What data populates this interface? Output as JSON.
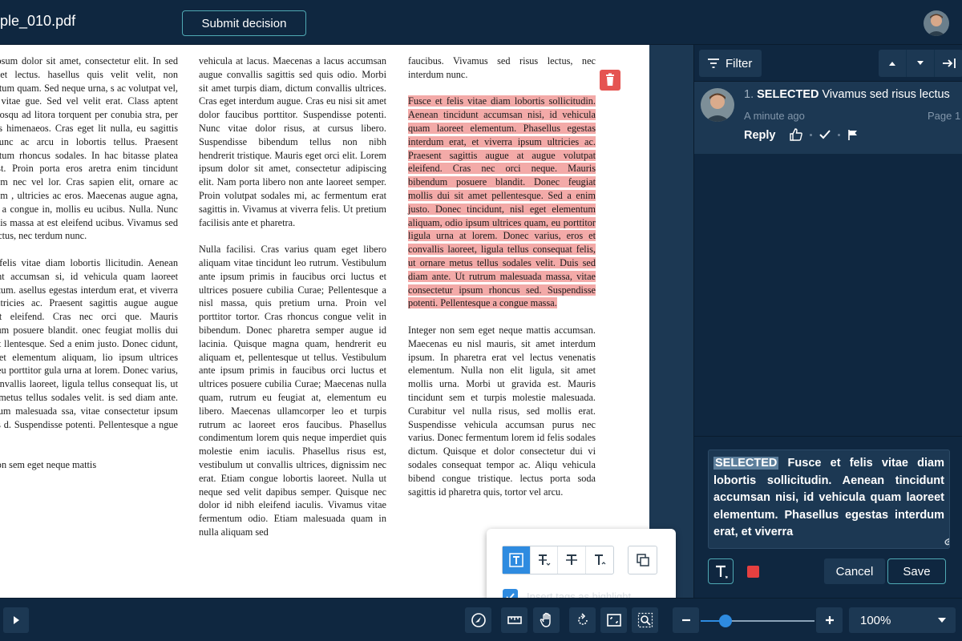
{
  "header": {
    "doc_title": "ple_010.pdf",
    "submit_label": "Submit decision"
  },
  "document": {
    "col1": [
      "orem ipsum dolor sit amet, consectetur elit. In sed imperdiet lectus. hasellus quis velit velit, non ndimentum quam. Sed neque urna, s ac volutpat vel, laoreet vitae gue. Sed vel velit erat. Class aptent taciti ciosqu ad litora torquent per conubia stra, per inceptos himenaeos. Cras eget lit nulla, eu sagittis elit. Nunc ac arcu in lobortis tellus. Praesent ndimentum rhoncus sodales. In hac bitasse platea dictumst. Proin porta eros aretra enim tincidunt dignissim nec vel lor. Cras sapien elit, ornare ac dignissim , ultricies ac eros. Maecenas augue agna, ultrices a congue in, mollis eu ucibus. Nulla. Nunc venenatis massa at est eleifend ucibus. Vivamus sed risus lectus, nec terdum nunc.",
      "sce et felis vitae diam lobortis llicitudin. Aenean tincidunt accumsan si, id vehicula quam laoreet elementum. asellus egestas interdum erat, et viverra sum ultricies ac. Praesent sagittis augue augue volutpat eleifend. Cras nec orci que. Mauris bibendum posuere blandit. onec feugiat mollis dui sit amet llentesque. Sed a enim justo. Donec cidunt, nisl eget elementum aliquam, lio ipsum ultrices quam, eu porttitor gula urna at lorem. Donec varius, eros et nvallis laoreet, ligula tellus consequat lis, ut ornare metus tellus sodales velit. is sed diam ante. Ut rutrum malesuada ssa, vitae consectetur ipsum rhoncus d. Suspendisse potenti. Pellentesque a ngue massa.",
      "teger non sem eget neque mattis"
    ],
    "col2": [
      "vehicula at lacus. Maecenas a lacus accumsan augue convallis sagittis sed quis odio. Morbi sit amet turpis diam, dictum convallis ultrices. Cras eget interdum augue. Cras eu nisi sit amet dolor faucibus porttitor. Suspendisse potenti. Nunc vitae dolor risus, at cursus libero. Suspendisse bibendum tellus non nibh hendrerit tristique. Mauris eget orci elit. Lorem ipsum dolor sit amet, consectetur adipiscing elit. Nam porta libero non ante laoreet semper. Proin volutpat sodales mi, ac fermentum erat sagittis in. Vivamus at viverra felis. Ut pretium facilisis ante et pharetra.",
      "Nulla facilisi. Cras varius quam eget libero aliquam vitae tincidunt leo rutrum. Vestibulum ante ipsum primis in faucibus orci luctus et ultrices posuere cubilia Curae; Pellentesque a nisl massa, quis pretium urna. Proin vel porttitor tortor. Cras rhoncus congue velit in bibendum. Donec pharetra semper augue id lacinia. Quisque magna quam, hendrerit eu aliquam et, pellentesque ut tellus. Vestibulum ante ipsum primis in faucibus orci luctus et ultrices posuere cubilia Curae; Maecenas nulla quam, rutrum eu feugiat at, elementum eu libero. Maecenas ullamcorper leo et turpis rutrum ac laoreet eros faucibus. Phasellus condimentum lorem quis neque imperdiet quis molestie enim iaculis. Phasellus risus est, vestibulum ut convallis ultrices, dignissim nec erat. Etiam congue lobortis laoreet. Nulla ut neque sed velit dapibus semper. Quisque nec dolor id nibh eleifend iaculis. Vivamus vitae fermentum odio. Etiam malesuada quam in nulla aliquam sed"
    ],
    "col3_p1": "faucibus. Vivamus sed risus lectus, nec interdum nunc.",
    "col3_highlight": "Fusce et felis vitae diam lobortis sollicitudin. Aenean tincidunt accumsan nisi, id vehicula quam laoreet elementum. Phasellus egestas interdum erat, et viverra ipsum ultricies ac. Praesent sagittis augue at augue volutpat eleifend. Cras nec orci neque. Mauris bibendum posuere blandit. Donec feugiat mollis dui sit amet pellentesque. Sed a enim justo. Donec tincidunt, nisl eget elementum aliquam, odio ipsum ultrices quam, eu porttitor ligula urna at lorem. Donec varius, eros et convallis laoreet, ligula tellus consequat felis, ut ornare metus tellus sodales velit. Duis sed diam ante. Ut rutrum malesuada massa, vitae consectetur ipsum rhoncus sed. Suspendisse potenti. Pellentesque a congue massa.",
    "col3_p3": "Integer non sem eget neque mattis accumsan. Maecenas eu nisl mauris, sit amet interdum ipsum. In pharetra erat vel lectus venenatis elementum. Nulla non elit ligula, sit amet mollis urna. Morbi ut gravida est. Mauris tincidunt sem et turpis molestie malesuada. Curabitur vel nulla risus, sed mollis erat. Suspendisse vehicula accumsan purus nec varius. Donec fermentum lorem id felis sodales dictum. Quisque et dolor consectetur dui vi sodales consequat tempor ac. Aliqu vehicula bibend congue tristique. lectus porta soda sagittis id pharetra quis, tortor vel arcu."
  },
  "float_toolbar": {
    "checkbox_label": "Insert tags as highlight",
    "checked": true
  },
  "panel": {
    "filter_label": "Filter",
    "comment": {
      "number": "1.",
      "tag": "SELECTED",
      "text": "Vivamus sed risus lectus",
      "time": "A minute ago",
      "page": "Page 1",
      "reply_label": "Reply"
    },
    "editor": {
      "tag": "SELECTED",
      "text": "Fusce et felis vitae diam lobortis sollicitudin. Aenean tincidunt accumsan nisi, id vehicula quam laoreet elementum. Phasellus egestas interdum erat, et viverra"
    },
    "cancel_label": "Cancel",
    "save_label": "Save",
    "text_color": "#e54040"
  },
  "bottom": {
    "zoom_label": "100%",
    "zoom_fraction": 0.22
  },
  "colors": {
    "background": "#0f2740",
    "panel": "#1c3853",
    "accent": "#2e8be0",
    "outline": "#4fa9b4",
    "highlight": "#f3aaa8",
    "trash": "#e55451"
  }
}
